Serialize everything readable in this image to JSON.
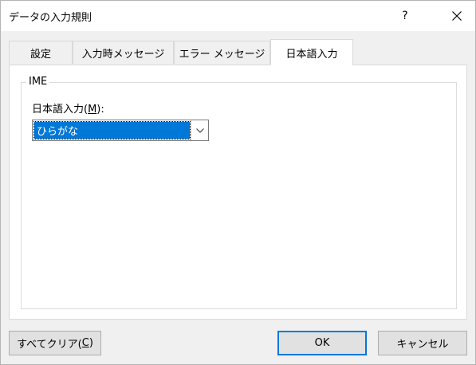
{
  "window": {
    "title": "データの入力規則",
    "help_glyph": "?",
    "close_icon": "close-icon"
  },
  "tabs": [
    {
      "label": "設定",
      "active": false
    },
    {
      "label": "入力時メッセージ",
      "active": false
    },
    {
      "label": "エラー メッセージ",
      "active": false
    },
    {
      "label": "日本語入力",
      "active": true
    }
  ],
  "ime_group": {
    "label": "IME",
    "field_label_prefix": "日本語入力(",
    "field_label_mnemonic": "M",
    "field_label_suffix": "):",
    "selected_value": "ひらがな"
  },
  "buttons": {
    "clear_prefix": "すべてクリア(",
    "clear_mnemonic": "C",
    "clear_suffix": ")",
    "ok": "OK",
    "cancel": "キャンセル"
  },
  "colors": {
    "accent": "#0078d7",
    "dialog_bg": "#f0f0f0",
    "panel_bg": "#ffffff"
  }
}
